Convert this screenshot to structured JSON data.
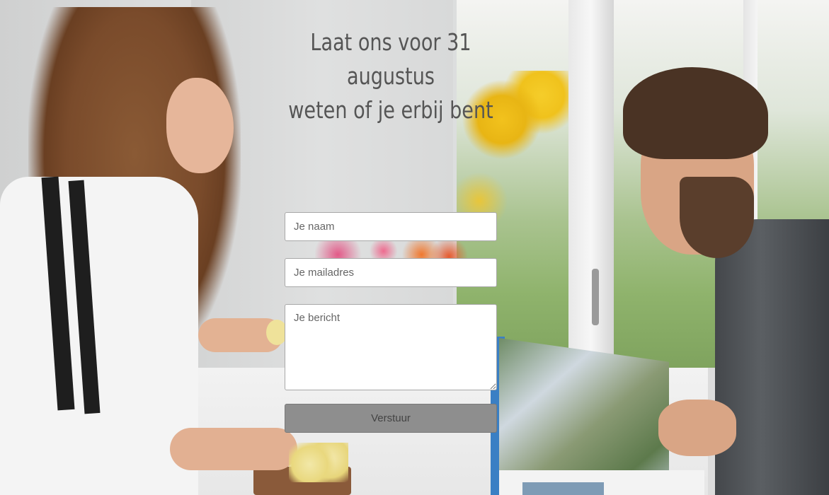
{
  "heading": {
    "line1": "Laat ons voor 31 augustus",
    "line2": "weten of je erbij bent"
  },
  "form": {
    "name_placeholder": "Je naam",
    "email_placeholder": "Je mailadres",
    "message_placeholder": "Je bericht",
    "submit_label": "Verstuur"
  },
  "colors": {
    "heading_text": "#555555",
    "submit_bg": "#8e8e8e",
    "field_bg": "#ffffff"
  }
}
